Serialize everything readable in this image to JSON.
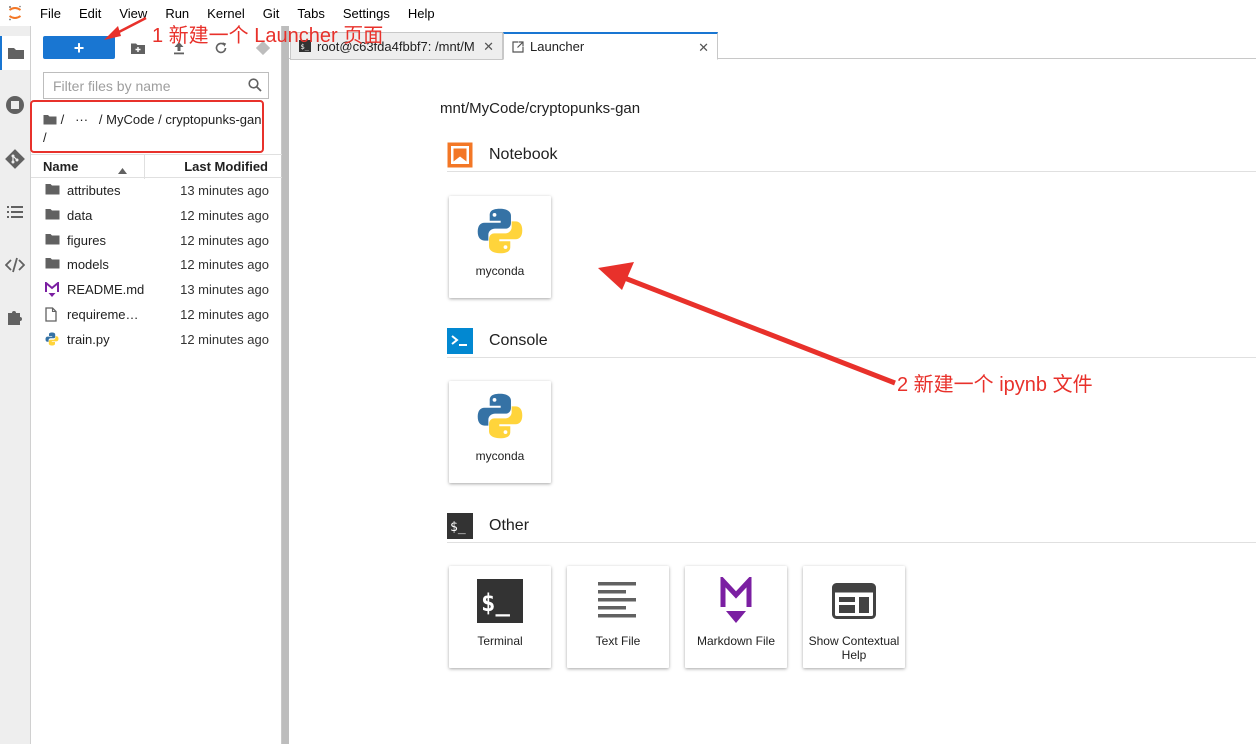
{
  "menubar": {
    "items": [
      "File",
      "Edit",
      "View",
      "Run",
      "Kernel",
      "Git",
      "Tabs",
      "Settings",
      "Help"
    ]
  },
  "iconbar": {
    "icons": [
      "folder-icon",
      "running-icon",
      "git-icon",
      "toc-icon",
      "code-icon",
      "extension-icon"
    ]
  },
  "filebrowser": {
    "new_button_label": "+",
    "filter_placeholder": "Filter files by name",
    "breadcrumb": "/   ···   / MyCode / cryptopunks-gan /",
    "header": {
      "name": "Name",
      "modified": "Last Modified"
    },
    "files": [
      {
        "name": "attributes",
        "modified": "13 minutes ago",
        "icon": "folder-icon"
      },
      {
        "name": "data",
        "modified": "12 minutes ago",
        "icon": "folder-icon"
      },
      {
        "name": "figures",
        "modified": "12 minutes ago",
        "icon": "folder-icon"
      },
      {
        "name": "models",
        "modified": "12 minutes ago",
        "icon": "folder-icon"
      },
      {
        "name": "README.md",
        "modified": "13 minutes ago",
        "icon": "markdown-icon"
      },
      {
        "name": "requireme…",
        "modified": "12 minutes ago",
        "icon": "file-icon"
      },
      {
        "name": "train.py",
        "modified": "12 minutes ago",
        "icon": "python-icon"
      }
    ]
  },
  "tabs": [
    {
      "label": "root@c63fda4fbbf7: /mnt/M",
      "icon": "terminal-icon",
      "active": false
    },
    {
      "label": "Launcher",
      "icon": "launcher-icon",
      "active": true
    }
  ],
  "launcher": {
    "cwd": "mnt/MyCode/cryptopunks-gan",
    "sections": {
      "notebook": {
        "title": "Notebook",
        "cards": [
          {
            "label": "myconda"
          }
        ]
      },
      "console": {
        "title": "Console",
        "cards": [
          {
            "label": "myconda"
          }
        ]
      },
      "other": {
        "title": "Other",
        "cards": [
          {
            "label": "Terminal"
          },
          {
            "label": "Text File"
          },
          {
            "label": "Markdown File"
          },
          {
            "label": "Show Contextual Help"
          }
        ]
      }
    }
  },
  "annotations": {
    "note1": "1 新建一个 Launcher 页面",
    "note2": "2 新建一个 ipynb 文件"
  },
  "colors": {
    "accent": "#1976d2",
    "annotation": "#e8312b",
    "notebook_orange": "#f37726",
    "console_blue": "#0288d1",
    "markdown_purple": "#7b1fa2"
  }
}
